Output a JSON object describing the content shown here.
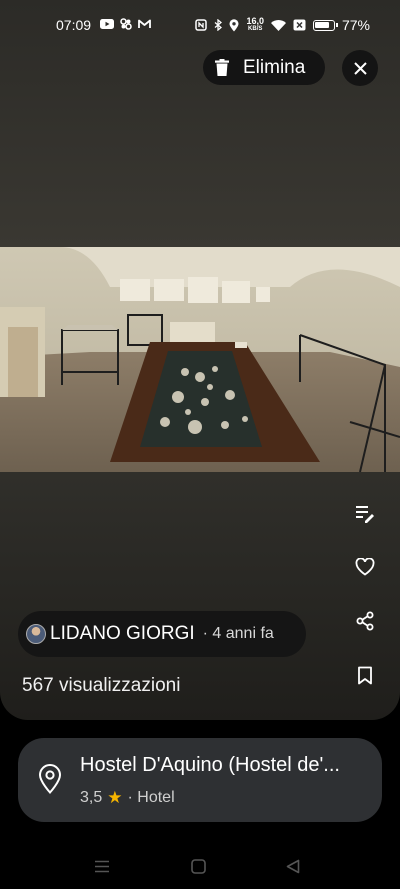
{
  "status_bar": {
    "time": "07:09",
    "speed_value": "16,0",
    "speed_unit": "KB/S",
    "battery": "77%"
  },
  "toolbar": {
    "delete_label": "Elimina",
    "close_icon": "close-icon"
  },
  "photo": {
    "subject": "museum-room-with-display-tables"
  },
  "actions": [
    "edit-caption-icon",
    "heart-icon",
    "share-icon",
    "bookmark-icon"
  ],
  "author": {
    "name": "LIDANO GIORGI",
    "age": "· 4 anni fa"
  },
  "stats": {
    "views": "567 visualizzazioni"
  },
  "place": {
    "name": "Hostel D'Aquino (Hostel de'...",
    "rating": "3,5",
    "category": "· Hotel"
  },
  "colors": {
    "star": "#f5b400",
    "chip_bg": "#151515",
    "card_bg": "#2e3033"
  }
}
